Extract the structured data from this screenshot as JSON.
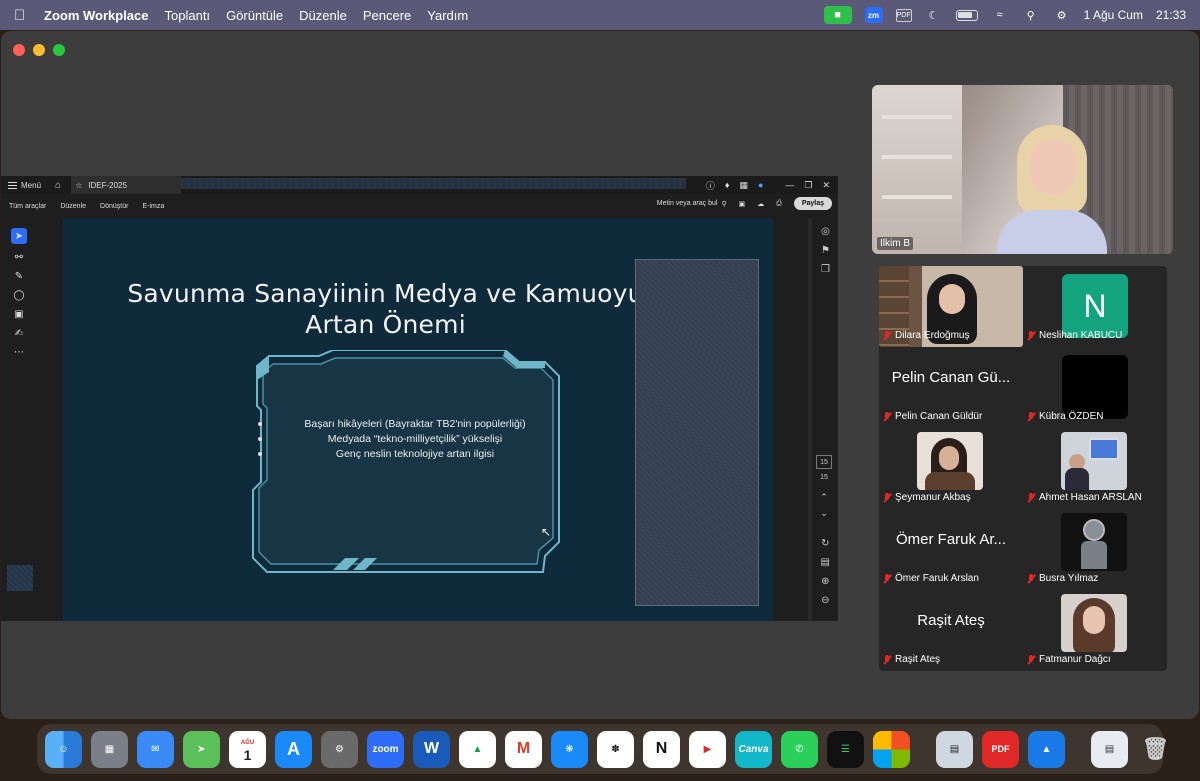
{
  "menubar": {
    "app": "Zoom Workplace",
    "items": [
      "Toplantı",
      "Görüntüle",
      "Düzenle",
      "Pencere",
      "Yardım"
    ],
    "zm_label": "zm",
    "pdf_label": "PDF",
    "date": "1 Ağu Cum",
    "time": "21:33"
  },
  "acrobat": {
    "menu_label": "Menü",
    "tab_title": "IDEF-2025",
    "toolbar": [
      "Tüm araçlar",
      "Düzenle",
      "Dönüştür",
      "E-imza"
    ],
    "search_label": "Metin veya araç bul",
    "share_label": "Paylaş",
    "page_current": "15",
    "page_total": "15"
  },
  "slide": {
    "title_line1": "Savunma Sanayiinin Medya ve Kamuoyu",
    "title_line2": "Artan Önemi",
    "bullets": [
      "Başarı hikâyeleri (Bayraktar TB2'nin popülerliği)",
      "Medyada “tekno-milliyetçilik” yükselişi",
      "Genç neslin teknolojiye artan ilgisi"
    ]
  },
  "speaker": {
    "name": "Ilkim B"
  },
  "participants": [
    {
      "name": "Dilara Erdoğmuş",
      "type": "photo",
      "muted": true
    },
    {
      "name": "Neslihan KABUCU",
      "type": "avatar",
      "letter": "N",
      "color": "#14a37f",
      "muted": true
    },
    {
      "name": "Pelin Canan Güldür",
      "type": "text",
      "display": "Pelin Canan Gü...",
      "muted": true
    },
    {
      "name": "Kübra ÖZDEN",
      "type": "avatar",
      "letter": "",
      "color": "#000000",
      "muted": true
    },
    {
      "name": "Şeymanur Akbaş",
      "type": "photo",
      "muted": true
    },
    {
      "name": "Ahmet Hasan ARSLAN",
      "type": "photo",
      "muted": true
    },
    {
      "name": "Ömer Faruk Arslan",
      "type": "text",
      "display": "Ömer Faruk Ar...",
      "muted": true
    },
    {
      "name": "Busra Yılmaz",
      "type": "photo",
      "muted": true
    },
    {
      "name": "Raşit Ateş",
      "type": "text",
      "display": "Raşit Ateş",
      "muted": true
    },
    {
      "name": "Fatmanur Dağcı",
      "type": "photo",
      "muted": true
    }
  ],
  "dock": {
    "calendar_month": "AĞU",
    "calendar_day": "1",
    "zoom_label": "zoom",
    "canva_label": "Canva",
    "pdf_label": "PDF"
  }
}
